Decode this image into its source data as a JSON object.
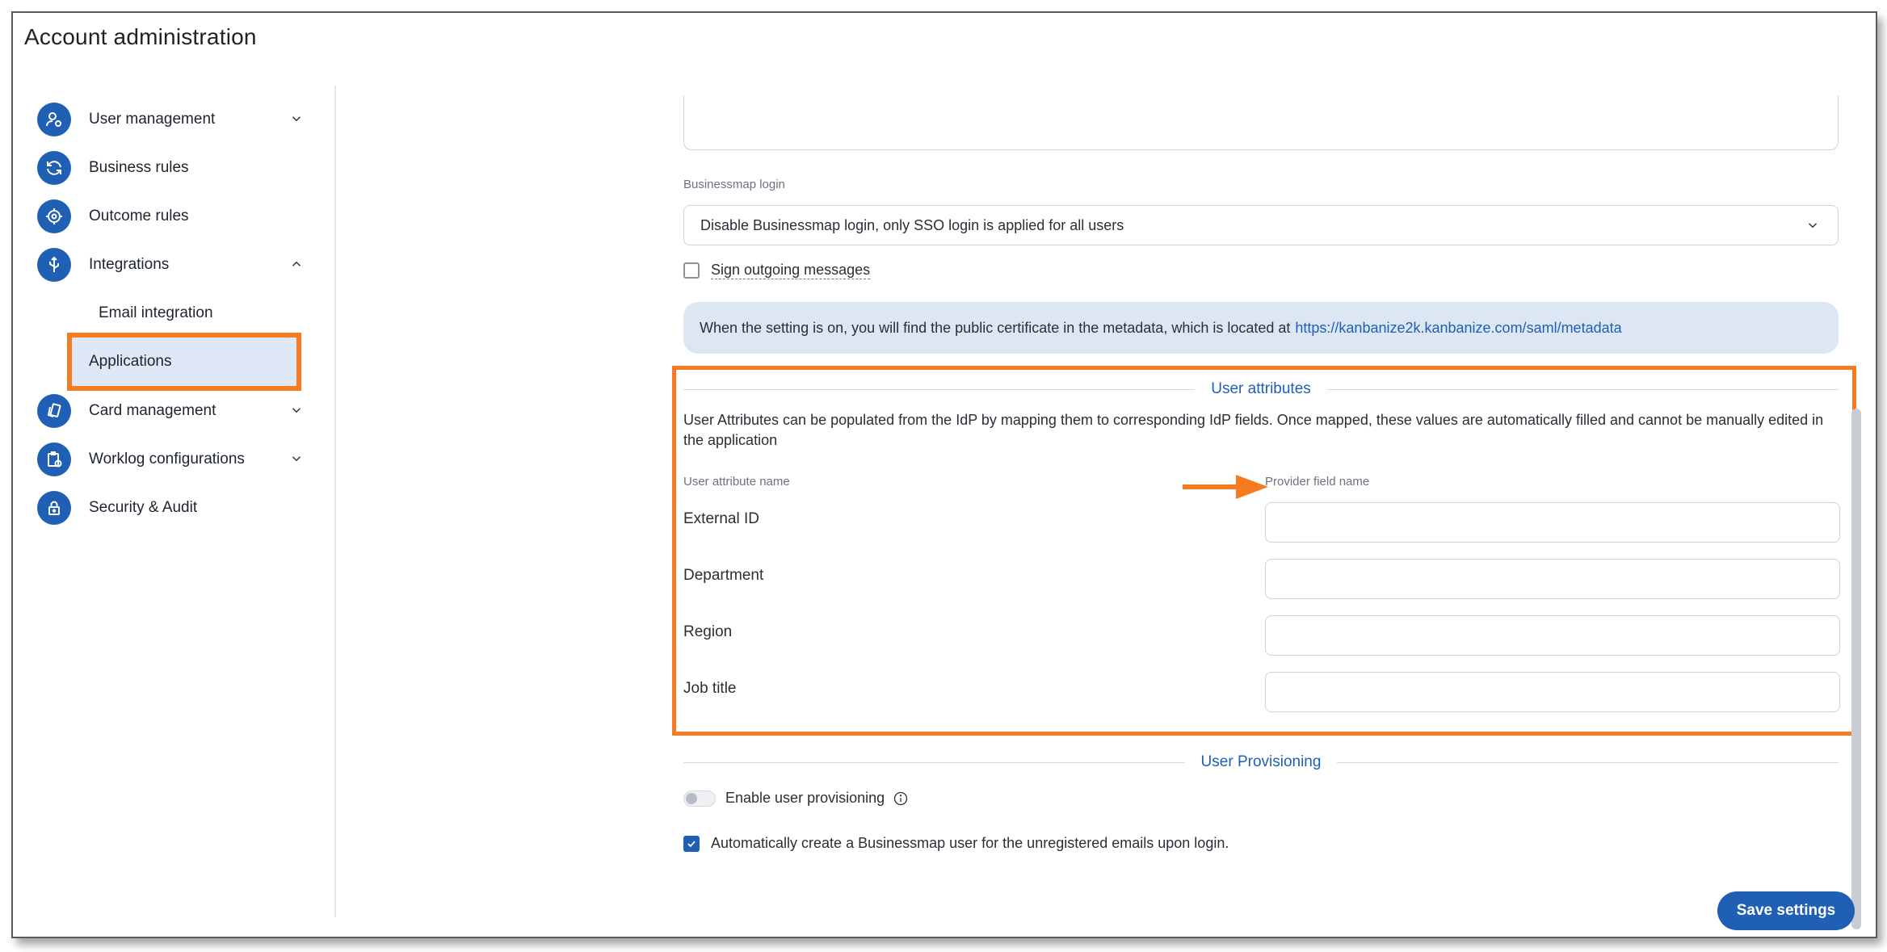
{
  "window": {
    "title": "Account administration"
  },
  "sidebar": {
    "items": [
      {
        "label": "User management",
        "icon": "user-gear-icon",
        "chevron": "down"
      },
      {
        "label": "Business rules",
        "icon": "refresh-icon",
        "chevron": ""
      },
      {
        "label": "Outcome rules",
        "icon": "target-icon",
        "chevron": ""
      },
      {
        "label": "Integrations",
        "icon": "usb-icon",
        "chevron": "up"
      },
      {
        "label": "Card management",
        "icon": "cards-icon",
        "chevron": "down"
      },
      {
        "label": "Worklog configurations",
        "icon": "clipboard-clock-icon",
        "chevron": "down"
      },
      {
        "label": "Security & Audit",
        "icon": "lock-icon",
        "chevron": ""
      }
    ],
    "sub_items": [
      {
        "label": "Email integration"
      },
      {
        "label": "Applications",
        "active": true
      }
    ]
  },
  "main": {
    "businessmap_login": {
      "label": "Businessmap login",
      "value": "Disable Businessmap login, only SSO login is applied for all users"
    },
    "sign_outgoing": {
      "label": "Sign outgoing messages",
      "checked": false
    },
    "info": {
      "text": "When the setting is on, you will find the public certificate in the metadata, which is located at",
      "link": "https://kanbanize2k.kanbanize.com/saml/metadata"
    },
    "user_attributes": {
      "title": "User attributes",
      "description": "User Attributes can be populated from the IdP by mapping them to corresponding IdP fields. Once mapped, these values are automatically filled and cannot be manually edited in the application",
      "col_name": "User attribute name",
      "col_provider": "Provider field name",
      "rows": [
        {
          "name": "External ID",
          "value": ""
        },
        {
          "name": "Department",
          "value": ""
        },
        {
          "name": "Region",
          "value": ""
        },
        {
          "name": "Job title",
          "value": ""
        }
      ]
    },
    "user_provisioning": {
      "title": "User Provisioning",
      "enable_label": "Enable user provisioning",
      "enable_on": false,
      "auto_create_label": "Automatically create a Businessmap user for the unregistered emails upon login.",
      "auto_create_checked": true
    },
    "save_label": "Save settings"
  },
  "colors": {
    "accent": "#1f5fb4",
    "highlight": "#f47b20",
    "info_bg": "#dde7f3"
  }
}
